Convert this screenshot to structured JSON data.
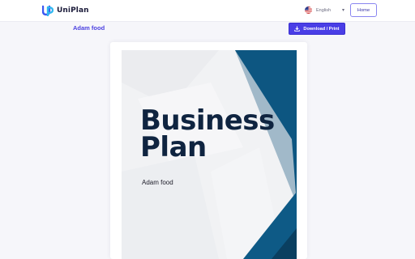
{
  "header": {
    "app_name": "UniPlan",
    "language": {
      "label": "English",
      "icon": "us-flag-icon"
    },
    "home_label": "Home"
  },
  "document": {
    "title": "Adam food",
    "download_label": "Download / Print"
  },
  "cover": {
    "title_line1": "Business",
    "title_line2": "Plan",
    "subtitle": "Adam food"
  },
  "colors": {
    "brand": "#4a3ee6",
    "cover_navy": "#0f2440",
    "cover_blue": "#0e5a86"
  }
}
